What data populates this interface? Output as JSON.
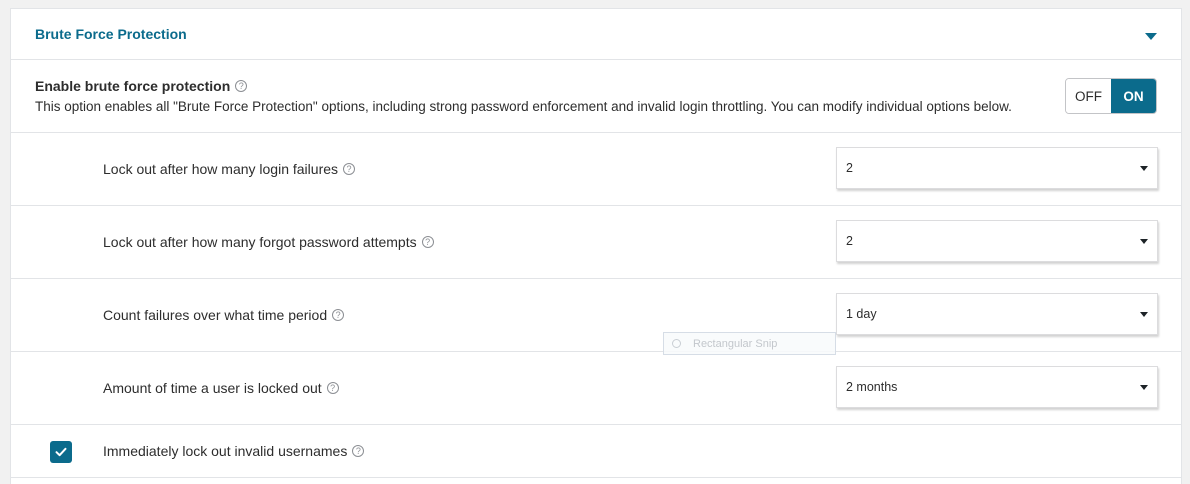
{
  "section": {
    "title": "Brute Force Protection"
  },
  "master": {
    "label": "Enable brute force protection",
    "description": "This option enables all \"Brute Force Protection\" options, including strong password enforcement and invalid login throttling. You can modify individual options below.",
    "toggle_off": "OFF",
    "toggle_on": "ON",
    "state": "on"
  },
  "options": [
    {
      "label": "Lock out after how many login failures",
      "value": "2"
    },
    {
      "label": "Lock out after how many forgot password attempts",
      "value": "2"
    },
    {
      "label": "Count failures over what time period",
      "value": "1 day"
    },
    {
      "label": "Amount of time a user is locked out",
      "value": "2 months"
    }
  ],
  "immediate_lockout": {
    "label": "Immediately lock out invalid usernames",
    "checked": true
  },
  "overlay": {
    "tooltip": "Rectangular Snip"
  },
  "help_glyph": "?",
  "colors": {
    "accent": "#0b6b8c",
    "border": "#e2e4e7",
    "text": "#2d2d2d"
  }
}
